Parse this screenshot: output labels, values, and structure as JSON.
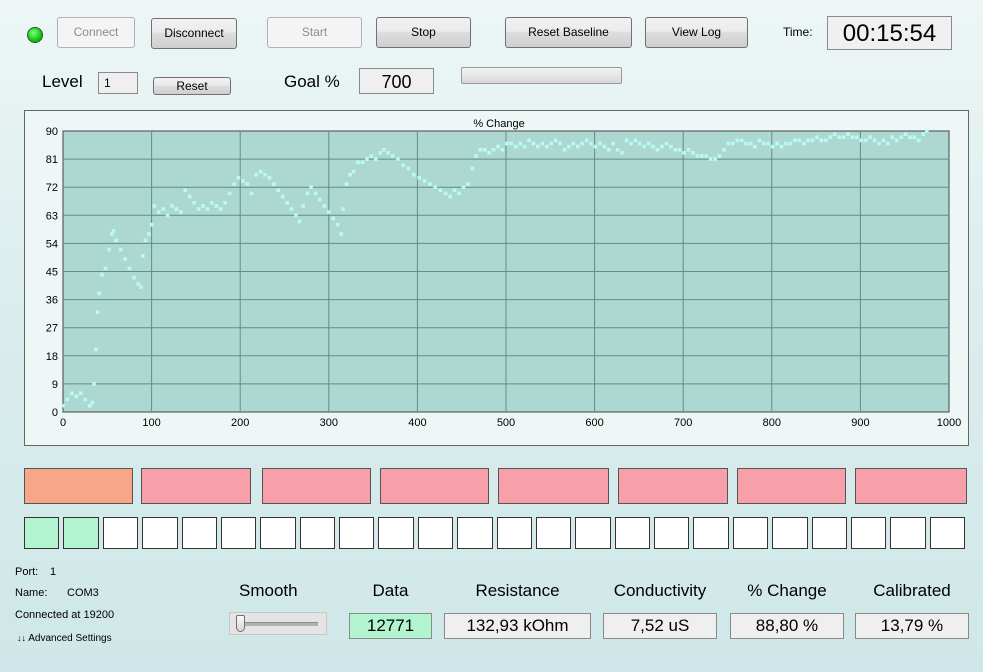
{
  "status_led_color": "#19c919",
  "toolbar": {
    "connect_label": "Connect",
    "disconnect_label": "Disconnect",
    "start_label": "Start",
    "stop_label": "Stop",
    "reset_baseline_label": "Reset Baseline",
    "view_log_label": "View Log"
  },
  "time": {
    "label": "Time:",
    "value": "00:15:54"
  },
  "level": {
    "label": "Level",
    "value": "1",
    "reset_label": "Reset"
  },
  "goal": {
    "label": "Goal %",
    "value": "700",
    "progress": 0
  },
  "chart_data": {
    "type": "scatter",
    "title": "% Change",
    "xlabel": "",
    "ylabel": "",
    "xlim": [
      0,
      1000
    ],
    "ylim": [
      0,
      90
    ],
    "x_ticks": [
      0,
      100,
      200,
      300,
      400,
      500,
      600,
      700,
      800,
      900,
      1000
    ],
    "y_ticks": [
      0,
      9,
      18,
      27,
      36,
      45,
      54,
      63,
      72,
      81,
      90
    ],
    "grid": true,
    "background": "#add8d2",
    "point_color": "#b9fbf0",
    "series": [
      {
        "points": [
          [
            0,
            2
          ],
          [
            5,
            4
          ],
          [
            10,
            6
          ],
          [
            15,
            5
          ],
          [
            20,
            6
          ],
          [
            25,
            4
          ],
          [
            30,
            2
          ],
          [
            33,
            3
          ],
          [
            35,
            9
          ],
          [
            37,
            20
          ],
          [
            39,
            32
          ],
          [
            41,
            38
          ],
          [
            44,
            44
          ],
          [
            48,
            46
          ],
          [
            52,
            52
          ],
          [
            55,
            57
          ],
          [
            57,
            58
          ],
          [
            60,
            55
          ],
          [
            65,
            52
          ],
          [
            70,
            49
          ],
          [
            75,
            46
          ],
          [
            80,
            43
          ],
          [
            85,
            41
          ],
          [
            88,
            40
          ],
          [
            90,
            50
          ],
          [
            93,
            55
          ],
          [
            97,
            57
          ],
          [
            100,
            60
          ],
          [
            103,
            66
          ],
          [
            108,
            64
          ],
          [
            113,
            65
          ],
          [
            118,
            63
          ],
          [
            123,
            66
          ],
          [
            128,
            65
          ],
          [
            133,
            64
          ],
          [
            138,
            71
          ],
          [
            143,
            69
          ],
          [
            148,
            67
          ],
          [
            153,
            65
          ],
          [
            158,
            66
          ],
          [
            163,
            65
          ],
          [
            168,
            67
          ],
          [
            173,
            66
          ],
          [
            178,
            65
          ],
          [
            183,
            67
          ],
          [
            188,
            70
          ],
          [
            193,
            73
          ],
          [
            198,
            75
          ],
          [
            203,
            74
          ],
          [
            208,
            73
          ],
          [
            213,
            70
          ],
          [
            218,
            76
          ],
          [
            223,
            77
          ],
          [
            228,
            76
          ],
          [
            233,
            75
          ],
          [
            238,
            73
          ],
          [
            243,
            71
          ],
          [
            248,
            69
          ],
          [
            253,
            67
          ],
          [
            258,
            65
          ],
          [
            263,
            63
          ],
          [
            267,
            61
          ],
          [
            271,
            66
          ],
          [
            276,
            70
          ],
          [
            280,
            72
          ],
          [
            285,
            70
          ],
          [
            290,
            68
          ],
          [
            295,
            66
          ],
          [
            300,
            64
          ],
          [
            305,
            62
          ],
          [
            310,
            60
          ],
          [
            314,
            57
          ],
          [
            316,
            65
          ],
          [
            320,
            73
          ],
          [
            324,
            76
          ],
          [
            328,
            77
          ],
          [
            333,
            80
          ],
          [
            338,
            80
          ],
          [
            343,
            81
          ],
          [
            348,
            82
          ],
          [
            353,
            81
          ],
          [
            358,
            83
          ],
          [
            362,
            84
          ],
          [
            367,
            83
          ],
          [
            372,
            82
          ],
          [
            378,
            81
          ],
          [
            384,
            79
          ],
          [
            390,
            78
          ],
          [
            396,
            76
          ],
          [
            402,
            75
          ],
          [
            408,
            74
          ],
          [
            414,
            73
          ],
          [
            420,
            72
          ],
          [
            426,
            71
          ],
          [
            432,
            70
          ],
          [
            437,
            69
          ],
          [
            442,
            71
          ],
          [
            447,
            70
          ],
          [
            452,
            72
          ],
          [
            457,
            73
          ],
          [
            462,
            78
          ],
          [
            466,
            82
          ],
          [
            471,
            84
          ],
          [
            476,
            84
          ],
          [
            481,
            83
          ],
          [
            486,
            84
          ],
          [
            491,
            85
          ],
          [
            496,
            84
          ],
          [
            501,
            86
          ],
          [
            506,
            86
          ],
          [
            511,
            85
          ],
          [
            516,
            86
          ],
          [
            521,
            85
          ],
          [
            526,
            87
          ],
          [
            531,
            86
          ],
          [
            536,
            85
          ],
          [
            541,
            86
          ],
          [
            546,
            85
          ],
          [
            551,
            86
          ],
          [
            556,
            87
          ],
          [
            561,
            86
          ],
          [
            566,
            84
          ],
          [
            571,
            85
          ],
          [
            576,
            86
          ],
          [
            581,
            85
          ],
          [
            586,
            86
          ],
          [
            591,
            87
          ],
          [
            596,
            86
          ],
          [
            601,
            85
          ],
          [
            606,
            86
          ],
          [
            611,
            85
          ],
          [
            616,
            84
          ],
          [
            621,
            86
          ],
          [
            626,
            84
          ],
          [
            631,
            83
          ],
          [
            636,
            87
          ],
          [
            641,
            86
          ],
          [
            646,
            87
          ],
          [
            651,
            86
          ],
          [
            656,
            85
          ],
          [
            661,
            86
          ],
          [
            666,
            85
          ],
          [
            671,
            84
          ],
          [
            676,
            85
          ],
          [
            681,
            86
          ],
          [
            686,
            85
          ],
          [
            691,
            84
          ],
          [
            696,
            84
          ],
          [
            701,
            83
          ],
          [
            706,
            84
          ],
          [
            711,
            83
          ],
          [
            716,
            82
          ],
          [
            721,
            82
          ],
          [
            726,
            82
          ],
          [
            731,
            81
          ],
          [
            736,
            81
          ],
          [
            741,
            82
          ],
          [
            746,
            84
          ],
          [
            751,
            86
          ],
          [
            756,
            86
          ],
          [
            761,
            87
          ],
          [
            766,
            87
          ],
          [
            771,
            86
          ],
          [
            776,
            86
          ],
          [
            781,
            85
          ],
          [
            786,
            87
          ],
          [
            791,
            86
          ],
          [
            796,
            86
          ],
          [
            801,
            85
          ],
          [
            806,
            86
          ],
          [
            811,
            85
          ],
          [
            816,
            86
          ],
          [
            821,
            86
          ],
          [
            826,
            87
          ],
          [
            831,
            87
          ],
          [
            836,
            86
          ],
          [
            841,
            87
          ],
          [
            846,
            87
          ],
          [
            851,
            88
          ],
          [
            856,
            87
          ],
          [
            861,
            87
          ],
          [
            866,
            88
          ],
          [
            871,
            89
          ],
          [
            876,
            88
          ],
          [
            881,
            88
          ],
          [
            886,
            89
          ],
          [
            891,
            88
          ],
          [
            896,
            88
          ],
          [
            901,
            87
          ],
          [
            906,
            87
          ],
          [
            911,
            88
          ],
          [
            916,
            87
          ],
          [
            921,
            86
          ],
          [
            926,
            87
          ],
          [
            931,
            86
          ],
          [
            936,
            88
          ],
          [
            941,
            87
          ],
          [
            946,
            88
          ],
          [
            951,
            89
          ],
          [
            956,
            88
          ],
          [
            961,
            88
          ],
          [
            966,
            87
          ],
          [
            971,
            89
          ],
          [
            975,
            90
          ]
        ]
      }
    ]
  },
  "level_boxes": {
    "colors": [
      "#f8a688",
      "#f8a0aa",
      "#f8a0aa",
      "#f8a0aa",
      "#f8a0aa",
      "#f8a0aa",
      "#f8a0aa",
      "#f8a0aa"
    ],
    "fill_colors": [
      "#b2f3d0",
      "#b2f3d0",
      "#ffffff",
      "#ffffff",
      "#ffffff",
      "#ffffff",
      "#ffffff",
      "#ffffff",
      "#ffffff",
      "#ffffff",
      "#ffffff",
      "#ffffff",
      "#ffffff",
      "#ffffff",
      "#ffffff",
      "#ffffff",
      "#ffffff",
      "#ffffff",
      "#ffffff",
      "#ffffff",
      "#ffffff",
      "#ffffff",
      "#ffffff",
      "#ffffff"
    ]
  },
  "connection": {
    "port_label": "Port:",
    "port_value": "1",
    "name_label": "Name:",
    "name_value": "COM3",
    "status": "Connected at 19200",
    "advanced_label": "Advanced Settings"
  },
  "smooth": {
    "label": "Smooth",
    "value": 0
  },
  "readouts": {
    "data": {
      "label": "Data",
      "value": "12771",
      "highlight": "#b2f3d0"
    },
    "resistance": {
      "label": "Resistance",
      "value": "132,93 kOhm"
    },
    "conductivity": {
      "label": "Conductivity",
      "value": "7,52 uS"
    },
    "change": {
      "label": "% Change",
      "value": "88,80 %"
    },
    "calibrated": {
      "label": "Calibrated",
      "value": "13,79 %"
    }
  }
}
